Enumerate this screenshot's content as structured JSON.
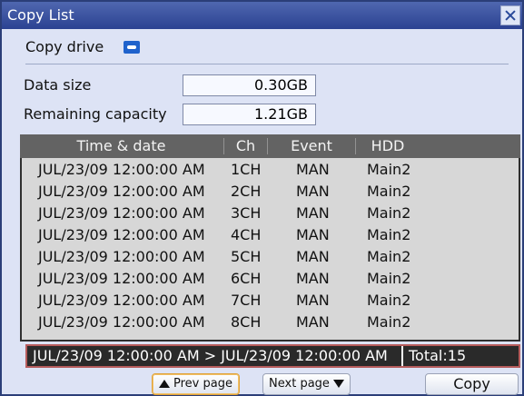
{
  "window": {
    "title": "Copy List"
  },
  "copy_drive": {
    "label": "Copy drive",
    "icon": "sd-card-icon"
  },
  "fields": {
    "data_size": {
      "label": "Data size",
      "value": "0.30GB"
    },
    "remaining_capacity": {
      "label": "Remaining capacity",
      "value": "1.21GB"
    }
  },
  "table": {
    "headers": [
      "Time & date",
      "Ch",
      "Event",
      "HDD"
    ],
    "rows": [
      {
        "time_date": "JUL/23/09 12:00:00 AM",
        "ch": "1CH",
        "event": "MAN",
        "hdd": "Main2"
      },
      {
        "time_date": "JUL/23/09 12:00:00 AM",
        "ch": "2CH",
        "event": "MAN",
        "hdd": "Main2"
      },
      {
        "time_date": "JUL/23/09 12:00:00 AM",
        "ch": "3CH",
        "event": "MAN",
        "hdd": "Main2"
      },
      {
        "time_date": "JUL/23/09 12:00:00 AM",
        "ch": "4CH",
        "event": "MAN",
        "hdd": "Main2"
      },
      {
        "time_date": "JUL/23/09 12:00:00 AM",
        "ch": "5CH",
        "event": "MAN",
        "hdd": "Main2"
      },
      {
        "time_date": "JUL/23/09 12:00:00 AM",
        "ch": "6CH",
        "event": "MAN",
        "hdd": "Main2"
      },
      {
        "time_date": "JUL/23/09 12:00:00 AM",
        "ch": "7CH",
        "event": "MAN",
        "hdd": "Main2"
      },
      {
        "time_date": "JUL/23/09 12:00:00 AM",
        "ch": "8CH",
        "event": "MAN",
        "hdd": "Main2"
      }
    ]
  },
  "status": {
    "range": "JUL/23/09 12:00:00 AM > JUL/23/09 12:00:00 AM",
    "total": "Total:15"
  },
  "buttons": {
    "prev": "Prev page",
    "next": "Next page",
    "copy": "Copy"
  },
  "colors": {
    "title_bar": "#2b4292",
    "panel": "#dde3f5",
    "table_header": "#636363",
    "status_border": "#b65c5c",
    "selected_button": "#e0a33a"
  }
}
